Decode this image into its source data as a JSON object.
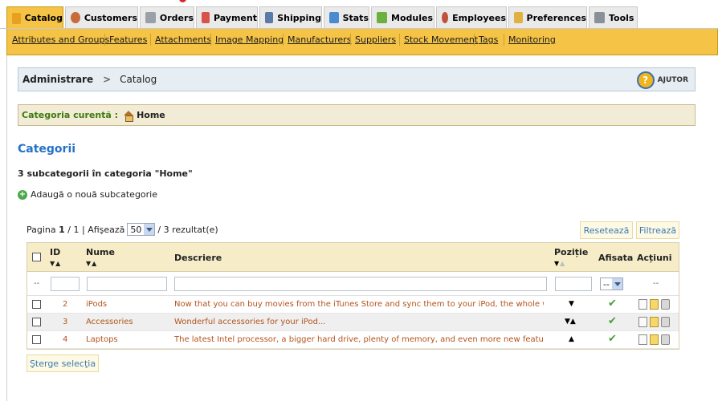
{
  "tabs": [
    {
      "label": "Catalog",
      "icon": "catalog-icon",
      "active": true
    },
    {
      "label": "Customers",
      "icon": "customers-icon"
    },
    {
      "label": "Orders",
      "icon": "orders-icon"
    },
    {
      "label": "Payment",
      "icon": "payment-icon"
    },
    {
      "label": "Shipping",
      "icon": "shipping-icon"
    },
    {
      "label": "Stats",
      "icon": "stats-icon"
    },
    {
      "label": "Modules",
      "icon": "modules-icon"
    },
    {
      "label": "Employees",
      "icon": "employees-icon"
    },
    {
      "label": "Preferences",
      "icon": "preferences-icon"
    },
    {
      "label": "Tools",
      "icon": "tools-icon"
    }
  ],
  "subnav": [
    "Attributes and Groups",
    "Features",
    "Attachments",
    "Image Mapping",
    "Manufacturers",
    "Suppliers",
    "Stock Movement",
    "Tags",
    "Monitoring"
  ],
  "breadcrumb": {
    "root": "Administrare",
    "current": "Catalog",
    "help_label": "AJUTOR"
  },
  "current_category": {
    "label": "Categoria curentă :",
    "value": "Home"
  },
  "page_title": "Categorii",
  "subcategory_count": "3 subcategorii în categoria \"Home\"",
  "add_new": "Adaugă o nouă subcategorie",
  "pager": {
    "prefix": "Pagina",
    "page": "1",
    "total": "/ 1",
    "show_label": "| Afişează",
    "per_page": "50",
    "results": "/ 3 rezultat(e)"
  },
  "buttons": {
    "reset": "Resetează",
    "filter": "Filtrează",
    "delete_selection": "Şterge selecţia"
  },
  "columns": {
    "id": "ID",
    "name": "Nume",
    "description": "Descriere",
    "position": "Poziție",
    "displayed": "Afisata",
    "actions": "Acțiuni"
  },
  "filter": {
    "id_dash": "--",
    "displayed_select": "--",
    "actions_dash": "--"
  },
  "rows": [
    {
      "id": "2",
      "name": "iPods",
      "description": "Now that you can buy movies from the iTunes Store and sync them to your iPod, the whole wo...",
      "position": "▼",
      "displayed": "✔"
    },
    {
      "id": "3",
      "name": "Accessories",
      "description": "Wonderful accessories for your iPod...",
      "position": "▼▲",
      "displayed": "✔"
    },
    {
      "id": "4",
      "name": "Laptops",
      "description": "The latest Intel processor, a bigger hard drive, plenty of memory, and even more new featu...",
      "position": "▲",
      "displayed": "✔"
    }
  ]
}
